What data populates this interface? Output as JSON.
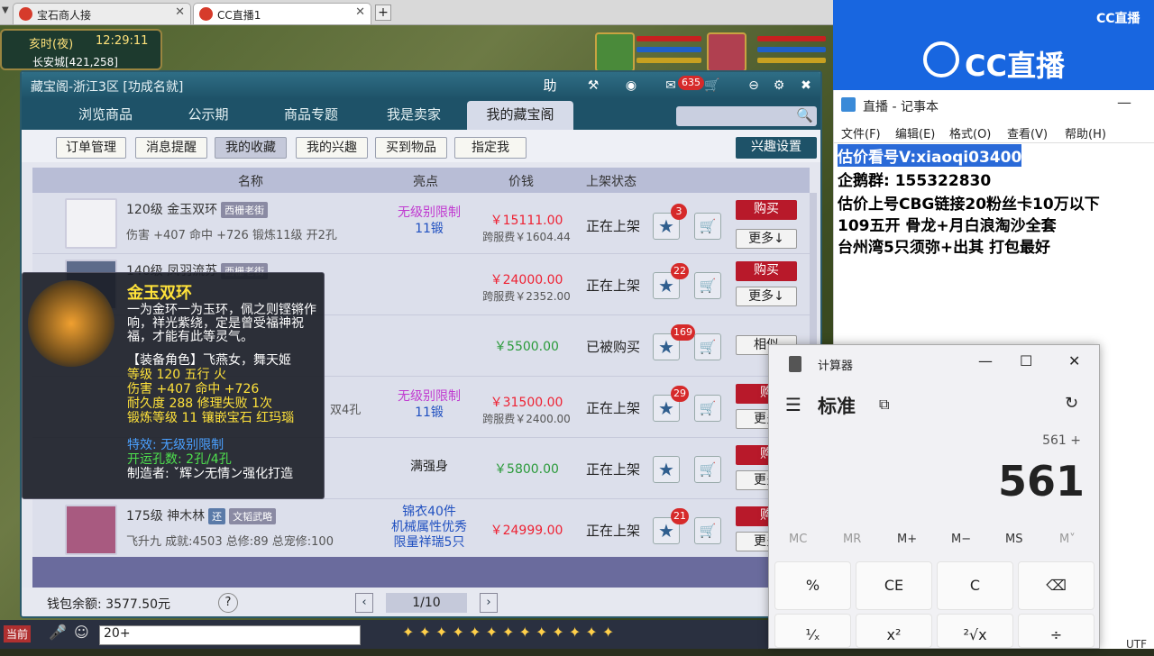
{
  "browser": {
    "tabs": [
      {
        "label": "宝石商人接"
      },
      {
        "label": "CC直播1"
      }
    ],
    "new_tab": "+"
  },
  "game": {
    "time_label": "亥时(夜)",
    "clock": "12:29:11",
    "location": "长安城[421,258]",
    "chat_input": "20+",
    "chat_channel": "当前"
  },
  "shop": {
    "title": "藏宝阁-浙江3区 [功成名就]",
    "title_buttons": {
      "help": "助",
      "mail_badge": "635"
    },
    "tabs": [
      {
        "label": "浏览商品"
      },
      {
        "label": "公示期"
      },
      {
        "label": "商品专题"
      },
      {
        "label": "我是卖家"
      },
      {
        "label": "我的藏宝阁"
      }
    ],
    "subtabs": [
      {
        "label": "订单管理"
      },
      {
        "label": "消息提醒"
      },
      {
        "label": "我的收藏"
      },
      {
        "label": "我的兴趣"
      },
      {
        "label": "买到物品"
      },
      {
        "label": "指定我"
      }
    ],
    "interest_button": "兴趣设置",
    "columns": {
      "name": "名称",
      "highlight": "亮点",
      "price": "价钱",
      "status": "上架状态"
    },
    "rows": [
      {
        "level_name": "120级 金玉双环",
        "tag": "西栅老街",
        "stats": "伤害 +407 命中 +726 锻炼11级 开2孔",
        "highlight": "无级别限制",
        "highlight2": "11锻",
        "price": "￥15111.00",
        "fee": "跨服费￥1604.44",
        "status": "正在上架",
        "stars": "3",
        "buy": "购买",
        "more": "更多↓"
      },
      {
        "level_name": "140级 凤羽流苏",
        "tag": "西栅老街",
        "stats": "",
        "highlight": "",
        "highlight2": "",
        "price": "￥24000.00",
        "fee": "跨服费￥2352.00",
        "status": "正在上架",
        "stars": "22",
        "buy": "购买",
        "more": "更多↓"
      },
      {
        "level_name": "",
        "tag": "",
        "stats": "",
        "highlight": "",
        "highlight2": "",
        "price": "￥5500.00",
        "fee": "",
        "status": "已被购买",
        "stars": "169",
        "buy": "",
        "more": "相似"
      },
      {
        "level_name": "",
        "tag": "",
        "stats": "双4孔",
        "highlight": "无级别限制",
        "highlight2": "11锻",
        "price": "￥31500.00",
        "fee": "跨服费￥2400.00",
        "status": "正在上架",
        "stars": "29",
        "buy": "购",
        "more": "更多"
      },
      {
        "level_name": "",
        "tag": "",
        "stats": "",
        "highlight": "满强身",
        "highlight2": "",
        "price": "￥5800.00",
        "fee": "",
        "status": "正在上架",
        "stars": "",
        "buy": "购",
        "more": "更多"
      },
      {
        "level_name": "175级 神木林",
        "tag": "文韬武略",
        "tag0": "还",
        "stats": "飞升九 成就:4503 总修:89 总宠修:100",
        "highlight": "锦衣40件",
        "highlight2": "机械属性优秀",
        "highlight3": "限量祥瑞5只",
        "price": "￥24999.00",
        "fee": "",
        "status": "正在上架",
        "stars": "21",
        "buy": "购",
        "more": "更多"
      }
    ],
    "wallet_label": "钱包余额: 3577.50元",
    "help_icon": "?",
    "page": "1/10",
    "tooltip": {
      "name": "金玉双环",
      "desc": "一为金环一为玉环，佩之则铿锵作响，祥光紫绕，定是曾受福神祝福，才能有此等灵气。",
      "role": "【装备角色】飞燕女，舞天姬",
      "level": "等级 120  五行 火",
      "attack": "伤害 +407 命中 +726",
      "durability": "耐久度 288  修理失败 1次",
      "forge": "锻炼等级 11  镶嵌宝石 红玛瑙",
      "special": "特效: 无级别限制",
      "holes": "开运孔数: 2孔/4孔",
      "maker": "制造者: ˇ辉ン无情ン强化打造"
    }
  },
  "cc": {
    "small_logo": "CC直播",
    "big_logo": "CC直播"
  },
  "notepad": {
    "title": "直播 - 记事本",
    "menu": [
      "文件(F)",
      "编辑(E)",
      "格式(O)",
      "查看(V)",
      "帮助(H)"
    ],
    "lines": [
      "估价看号V:xiaoqi03400",
      "企鹅群: 155322830",
      "估价上号CBG链接20粉丝卡10万以下",
      "109五开 骨龙+月白浪淘沙全套",
      "台州湾5只须弥+出其 打包最好"
    ],
    "status_tail": "UTF"
  },
  "calculator": {
    "title": "计算器",
    "mode": "标准",
    "expression": "561 +",
    "display": "561",
    "memory": [
      "MC",
      "MR",
      "M+",
      "M−",
      "MS",
      "M˅"
    ],
    "keys": [
      "%",
      "CE",
      "C",
      "⌫",
      "¹⁄ₓ",
      "x²",
      "²√x",
      "÷"
    ]
  },
  "colors": {
    "accent": "#1e5268",
    "buy": "#b8192a",
    "price": "#e22233",
    "cc": "#1866e0"
  }
}
